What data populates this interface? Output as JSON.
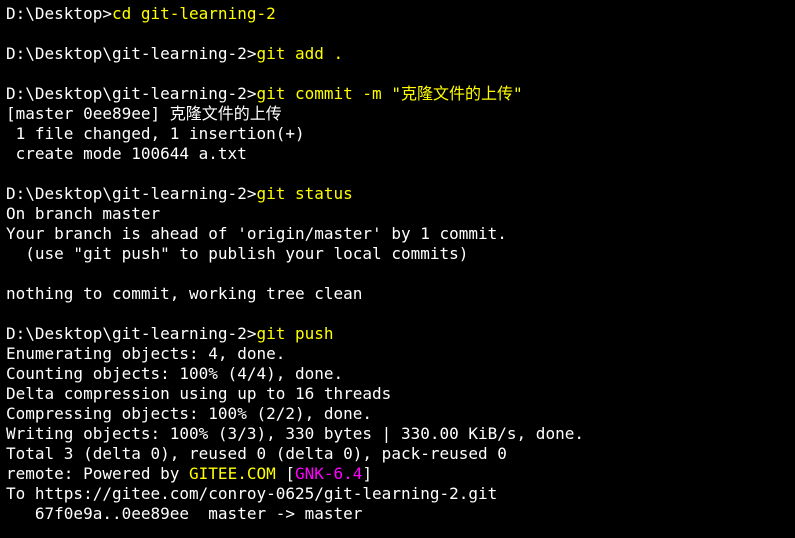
{
  "terminal": {
    "line1a": "D:\\Desktop>",
    "line1b": "cd git-learning-2",
    "blank1": " ",
    "line2a": "D:\\Desktop\\git-learning-2>",
    "line2b": "git add .",
    "blank2": " ",
    "line3a": "D:\\Desktop\\git-learning-2>",
    "line3b": "git commit -m \"克隆文件的上传\"",
    "line4": "[master 0ee89ee] 克隆文件的上传",
    "line5": " 1 file changed, 1 insertion(+)",
    "line6": " create mode 100644 a.txt",
    "blank3": " ",
    "line7a": "D:\\Desktop\\git-learning-2>",
    "line7b": "git status",
    "line8": "On branch master",
    "line9": "Your branch is ahead of 'origin/master' by 1 commit.",
    "line10": "  (use \"git push\" to publish your local commits)",
    "blank4": " ",
    "line11": "nothing to commit, working tree clean",
    "blank5": " ",
    "line12a": "D:\\Desktop\\git-learning-2>",
    "line12b": "git push",
    "line13": "Enumerating objects: 4, done.",
    "line14": "Counting objects: 100% (4/4), done.",
    "line15": "Delta compression using up to 16 threads",
    "line16": "Compressing objects: 100% (2/2), done.",
    "line17": "Writing objects: 100% (3/3), 330 bytes | 330.00 KiB/s, done.",
    "line18": "Total 3 (delta 0), reused 0 (delta 0), pack-reused 0",
    "line19a": "remote: Powered by ",
    "line19b": "GITEE.COM",
    "line19c": " [",
    "line19d": "GNK-6.4",
    "line19e": "]",
    "line20": "To https://gitee.com/conroy-0625/git-learning-2.git",
    "line21": "   67f0e9a..0ee89ee  master -> master"
  }
}
